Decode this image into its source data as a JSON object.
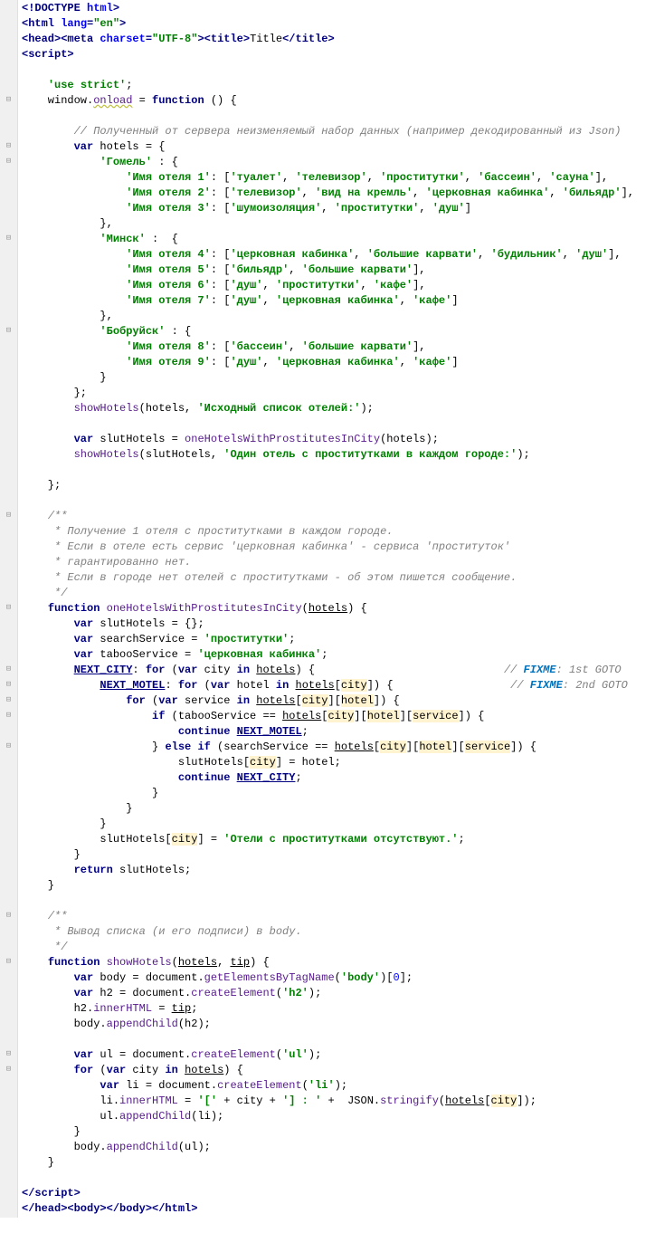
{
  "lines": [
    {
      "i": 0,
      "h": "<span class='tag'>&lt;!DOCTYPE <span class='attr'>html</span>&gt;</span>"
    },
    {
      "i": 0,
      "h": "<span class='tag'>&lt;html <span class='attr'>lang</span>=<span class='str'>\"en\"</span>&gt;</span>"
    },
    {
      "i": 0,
      "h": "<span class='tag'>&lt;head&gt;&lt;meta <span class='attr'>charset</span>=<span class='str'>\"UTF-8\"</span>&gt;&lt;title&gt;</span>Title<span class='tag'>&lt;/title&gt;</span>"
    },
    {
      "i": 0,
      "h": "<span class='tag'>&lt;script&gt;</span>"
    },
    {
      "i": 0,
      "h": ""
    },
    {
      "i": 4,
      "h": "<span class='str'>'use strict'</span>;"
    },
    {
      "i": 4,
      "h": "window.<span class='prop warn'>onload</span> = <span class='kw'>function</span> () {"
    },
    {
      "i": 4,
      "h": ""
    },
    {
      "i": 8,
      "h": "<span class='cm'>// Полученный от сервера неизменяемый набор данных (например декодированный из Json)</span>"
    },
    {
      "i": 8,
      "h": "<span class='kw'>var</span> hotels = {"
    },
    {
      "i": 12,
      "h": "<span class='str'>'Гомель'</span> : {"
    },
    {
      "i": 16,
      "h": "<span class='str'>'Имя отеля 1'</span>: [<span class='str'>'туалет'</span>, <span class='str'>'телевизор'</span>, <span class='str'>'проститутки'</span>, <span class='str'>'бассеин'</span>, <span class='str'>'сауна'</span>],"
    },
    {
      "i": 16,
      "h": "<span class='str'>'Имя отеля 2'</span>: [<span class='str'>'телевизор'</span>, <span class='str'>'вид на кремль'</span>, <span class='str'>'церковная кабинка'</span>, <span class='str'>'бильядр'</span>],"
    },
    {
      "i": 16,
      "h": "<span class='str'>'Имя отеля 3'</span>: [<span class='str'>'шумоизоляция'</span>, <span class='str'>'проститутки'</span>, <span class='str'>'душ'</span>]"
    },
    {
      "i": 12,
      "h": "},"
    },
    {
      "i": 12,
      "h": "<span class='str'>'Минск'</span> :  {"
    },
    {
      "i": 16,
      "h": "<span class='str'>'Имя отеля 4'</span>: [<span class='str'>'церковная кабинка'</span>, <span class='str'>'большие карвати'</span>, <span class='str'>'будильник'</span>, <span class='str'>'душ'</span>],"
    },
    {
      "i": 16,
      "h": "<span class='str'>'Имя отеля 5'</span>: [<span class='str'>'бильядр'</span>, <span class='str'>'большие карвати'</span>],"
    },
    {
      "i": 16,
      "h": "<span class='str'>'Имя отеля 6'</span>: [<span class='str'>'душ'</span>, <span class='str'>'проститутки'</span>, <span class='str'>'кафе'</span>],"
    },
    {
      "i": 16,
      "h": "<span class='str'>'Имя отеля 7'</span>: [<span class='str'>'душ'</span>, <span class='str'>'церковная кабинка'</span>, <span class='str'>'кафе'</span>]"
    },
    {
      "i": 12,
      "h": "},"
    },
    {
      "i": 12,
      "h": "<span class='str'>'Бобруйск'</span> : {"
    },
    {
      "i": 16,
      "h": "<span class='str'>'Имя отеля 8'</span>: [<span class='str'>'бассеин'</span>, <span class='str'>'большие карвати'</span>],"
    },
    {
      "i": 16,
      "h": "<span class='str'>'Имя отеля 9'</span>: [<span class='str'>'душ'</span>, <span class='str'>'церковная кабинка'</span>, <span class='str'>'кафе'</span>]"
    },
    {
      "i": 12,
      "h": "}"
    },
    {
      "i": 8,
      "h": "};"
    },
    {
      "i": 8,
      "h": "<span class='prop'>showHotels</span>(hotels, <span class='str'>'Исходный список отелей:'</span>);"
    },
    {
      "i": 4,
      "h": ""
    },
    {
      "i": 8,
      "h": "<span class='kw'>var</span> slutHotels = <span class='prop'>oneHotelsWithProstitutesInCity</span>(hotels);"
    },
    {
      "i": 8,
      "h": "<span class='prop'>showHotels</span>(slutHotels, <span class='str'>'Один отель с проститутками в каждом городе:'</span>);"
    },
    {
      "i": 4,
      "h": ""
    },
    {
      "i": 4,
      "h": "};"
    },
    {
      "i": 4,
      "h": ""
    },
    {
      "i": 4,
      "h": "<span class='cm'>/**</span>"
    },
    {
      "i": 5,
      "h": "<span class='cm'>* Получение 1 отеля с проститутками в каждом городе.</span>"
    },
    {
      "i": 5,
      "h": "<span class='cm'>* Если в отеле есть сервис 'церковная кабинка' - сервиса 'проституток'</span>"
    },
    {
      "i": 5,
      "h": "<span class='cm'>* гарантированно нет.</span>"
    },
    {
      "i": 5,
      "h": "<span class='cm'>* Если в городе нет отелей с проститутками - об этом пишется сообщение.</span>"
    },
    {
      "i": 5,
      "h": "<span class='cm'>*/</span>"
    },
    {
      "i": 4,
      "h": "<span class='kw'>function</span> <span class='prop'>oneHotelsWithProstitutesInCity</span>(<span class='ul'>hotels</span>) {"
    },
    {
      "i": 8,
      "h": "<span class='kw'>var</span> slutHotels = {};"
    },
    {
      "i": 8,
      "h": "<span class='kw'>var</span> searchService = <span class='str'>'проститутки'</span>;"
    },
    {
      "i": 8,
      "h": "<span class='kw'>var</span> tabooService = <span class='str'>'церковная кабинка'</span>;"
    },
    {
      "i": 8,
      "h": "<span class='kw ul'>NEXT_CITY</span>: <span class='kw'>for</span> (<span class='kw'>var</span> city <span class='kw'>in</span> <span class='ul'>hotels</span>) {                             <span class='cm'>// </span><span class='todo'>FIXME</span><span class='cm'>: 1st GOTO</span>"
    },
    {
      "i": 12,
      "h": "<span class='kw ul'>NEXT_MOTEL</span>: <span class='kw'>for</span> (<span class='kw'>var</span> hotel <span class='kw'>in</span> <span class='ul'>hotels</span>[<span class='hi'>city</span>]) {                  <span class='cm'>// </span><span class='todo'>FIXME</span><span class='cm'>: 2nd GOTO</span>"
    },
    {
      "i": 16,
      "h": "<span class='kw'>for</span> (<span class='kw'>var</span> service <span class='kw'>in</span> <span class='ul'>hotels</span>[<span class='hi'>city</span>][<span class='hi'>hotel</span>]) {"
    },
    {
      "i": 20,
      "h": "<span class='kw'>if</span> (tabooService == <span class='ul'>hotels</span>[<span class='hi'>city</span>][<span class='hi'>hotel</span>][<span class='hi'>service</span>]) {"
    },
    {
      "i": 24,
      "h": "<span class='kw'>continue</span> <span class='kw ul'>NEXT_MOTEL</span>;"
    },
    {
      "i": 20,
      "h": "} <span class='kw'>else if</span> (searchService == <span class='ul'>hotels</span>[<span class='hi'>city</span>][<span class='hi'>hotel</span>][<span class='hi'>service</span>]) {"
    },
    {
      "i": 24,
      "h": "slutHotels[<span class='hi'>city</span>] = hotel;"
    },
    {
      "i": 24,
      "h": "<span class='kw'>continue</span> <span class='kw ul'>NEXT_CITY</span>;"
    },
    {
      "i": 20,
      "h": "}"
    },
    {
      "i": 16,
      "h": "}"
    },
    {
      "i": 12,
      "h": "}"
    },
    {
      "i": 12,
      "h": "slutHotels[<span class='hi'>city</span>] = <span class='str'>'Отели с проститутками отсутствуют.'</span>;"
    },
    {
      "i": 8,
      "h": "}"
    },
    {
      "i": 8,
      "h": "<span class='kw'>return</span> slutHotels;"
    },
    {
      "i": 4,
      "h": "}"
    },
    {
      "i": 4,
      "h": ""
    },
    {
      "i": 4,
      "h": "<span class='cm'>/**</span>"
    },
    {
      "i": 5,
      "h": "<span class='cm'>* Вывод списка (и его подписи) в body.</span>"
    },
    {
      "i": 5,
      "h": "<span class='cm'>*/</span>"
    },
    {
      "i": 4,
      "h": "<span class='kw'>function</span> <span class='prop'>showHotels</span>(<span class='ul'>hotels</span>, <span class='ul'>tip</span>) {"
    },
    {
      "i": 8,
      "h": "<span class='kw'>var</span> body = document.<span class='prop'>getElementsByTagName</span>(<span class='str'>'body'</span>)[<span class='num'>0</span>];"
    },
    {
      "i": 8,
      "h": "<span class='kw'>var</span> h2 = document.<span class='prop'>createElement</span>(<span class='str'>'h2'</span>);"
    },
    {
      "i": 8,
      "h": "h2.<span class='prop'>innerHTML</span> = <span class='ul'>tip</span>;"
    },
    {
      "i": 8,
      "h": "body.<span class='prop'>appendChild</span>(h2);"
    },
    {
      "i": 4,
      "h": ""
    },
    {
      "i": 8,
      "h": "<span class='kw'>var</span> ul = document.<span class='prop'>createElement</span>(<span class='str'>'ul'</span>);"
    },
    {
      "i": 8,
      "h": "<span class='kw'>for</span> (<span class='kw'>var</span> city <span class='kw'>in</span> <span class='ul'>hotels</span>) {"
    },
    {
      "i": 12,
      "h": "<span class='kw'>var</span> li = document.<span class='prop'>createElement</span>(<span class='str'>'li'</span>);"
    },
    {
      "i": 12,
      "h": "li.<span class='prop'>innerHTML</span> = <span class='str'>'['</span> + city + <span class='str'>'] : '</span> +  JSON.<span class='prop'>stringify</span>(<span class='ul'>hotels</span>[<span class='hi'>city</span>]);"
    },
    {
      "i": 12,
      "h": "ul.<span class='prop'>appendChild</span>(li);"
    },
    {
      "i": 8,
      "h": "}"
    },
    {
      "i": 8,
      "h": "body.<span class='prop'>appendChild</span>(ul);"
    },
    {
      "i": 4,
      "h": "}"
    },
    {
      "i": 4,
      "h": ""
    },
    {
      "i": 0,
      "h": "<span class='tag'>&lt;/script&gt;</span>"
    },
    {
      "i": 0,
      "h": "<span class='tag'>&lt;/head&gt;&lt;body&gt;&lt;/body&gt;&lt;/html&gt;</span>"
    }
  ],
  "foldable": [
    6,
    9,
    10,
    15,
    21,
    33,
    39,
    43,
    44,
    45,
    46,
    48,
    59,
    62,
    68,
    69
  ]
}
